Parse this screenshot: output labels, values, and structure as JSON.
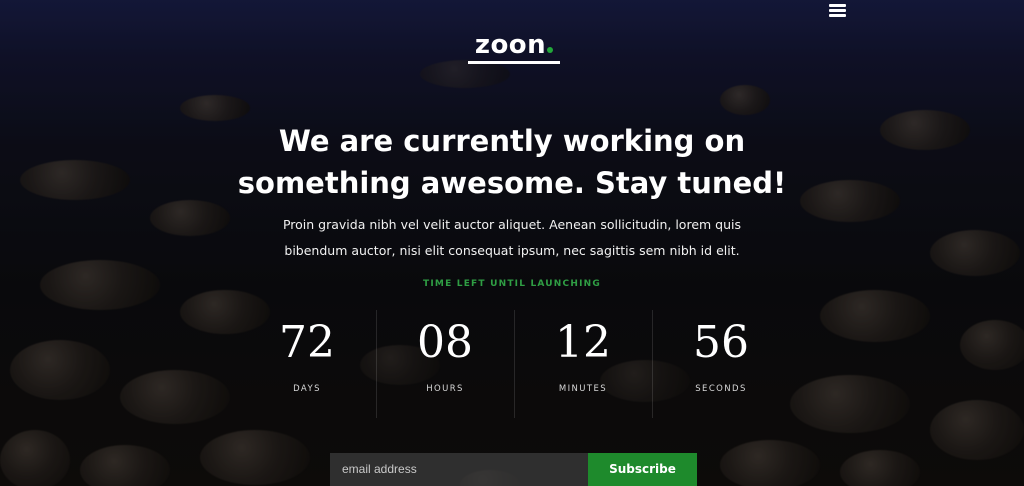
{
  "header": {
    "menu_icon": "hamburger-menu-icon",
    "logo": {
      "text": "zoon",
      "dot_color": "#22a83a"
    }
  },
  "hero": {
    "headline_line1": "We are currently working on",
    "headline_line2": "something awesome. Stay tuned!",
    "description_line1": "Proin gravida nibh vel velit auctor aliquet. Aenean sollicitudin, lorem quis",
    "description_line2": "bibendum auctor, nisi elit consequat ipsum, nec sagittis sem nibh id elit."
  },
  "countdown": {
    "label": "TIME LEFT UNTIL LAUNCHING",
    "label_color": "#2f9e44",
    "units": [
      {
        "value": "72",
        "label": "DAYS"
      },
      {
        "value": "08",
        "label": "HOURS"
      },
      {
        "value": "12",
        "label": "MINUTES"
      },
      {
        "value": "56",
        "label": "SECONDS"
      }
    ]
  },
  "subscribe": {
    "placeholder": "email address",
    "button_label": "Subscribe",
    "button_color": "#1e8a2c"
  }
}
